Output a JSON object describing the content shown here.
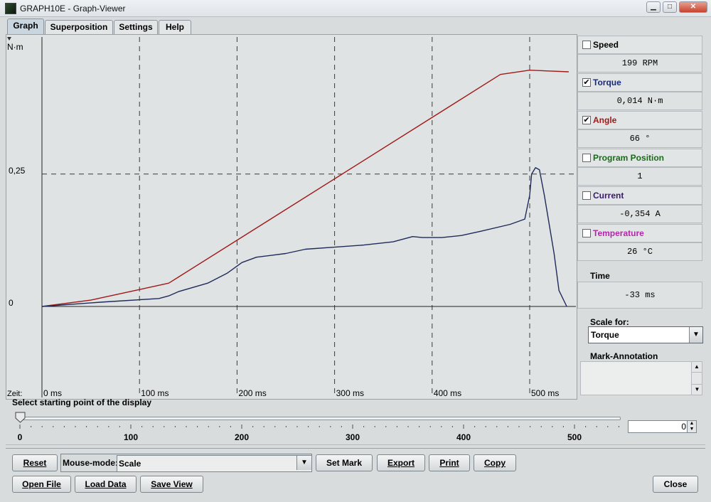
{
  "window": {
    "title": "GRAPH10E - Graph-Viewer",
    "min": "▁",
    "max": "□",
    "close": "✕"
  },
  "tabs": [
    {
      "label": "Graph",
      "active": true
    },
    {
      "label": "Superposition",
      "active": false
    },
    {
      "label": "Settings",
      "active": false
    },
    {
      "label": "Help",
      "active": false
    }
  ],
  "chart": {
    "unit_label": "N·m",
    "y_tick_labels": [
      "0,25",
      "0"
    ],
    "x_axis_prefix": "Zeit:",
    "x_tick_labels": [
      "0 ms",
      "100 ms",
      "200 ms",
      "300 ms",
      "400 ms",
      "500 ms"
    ]
  },
  "chart_data": {
    "type": "line",
    "xlabel": "Zeit:",
    "ylabel": "N·m",
    "xlim": [
      0,
      550
    ],
    "ylim": [
      -0.1,
      0.5
    ],
    "grid": true,
    "series": [
      {
        "name": "Angle",
        "color": "#a01a1a",
        "x": [
          0,
          50,
          100,
          130,
          300,
          470,
          500,
          540
        ],
        "y": [
          0,
          0.012,
          0.032,
          0.044,
          0.241,
          0.438,
          0.446,
          0.443
        ]
      },
      {
        "name": "Torque",
        "color": "#1f2a5a",
        "x": [
          0,
          60,
          120,
          130,
          140,
          170,
          190,
          205,
          220,
          250,
          270,
          300,
          330,
          360,
          380,
          390,
          410,
          430,
          450,
          480,
          495,
          500,
          502,
          506,
          510,
          515,
          525,
          530,
          538
        ],
        "y": [
          0,
          0.008,
          0.015,
          0.02,
          0.028,
          0.044,
          0.063,
          0.083,
          0.093,
          0.1,
          0.108,
          0.112,
          0.116,
          0.122,
          0.132,
          0.13,
          0.13,
          0.134,
          0.142,
          0.155,
          0.165,
          0.21,
          0.25,
          0.262,
          0.258,
          0.21,
          0.1,
          0.03,
          0.0
        ]
      }
    ],
    "reference_line_y": 0.25
  },
  "signals": [
    {
      "label": "Speed",
      "checked": false,
      "value": "199 RPM",
      "color": "#000000"
    },
    {
      "label": "Torque",
      "checked": true,
      "value": "0,014 N·m",
      "color": "#1a2a78"
    },
    {
      "label": "Angle",
      "checked": true,
      "value": "66 °",
      "color": "#a01a1a"
    },
    {
      "label": "Program Position",
      "checked": false,
      "value": "1",
      "color": "#1a6a1a"
    },
    {
      "label": "Current",
      "checked": false,
      "value": "-0,354 A",
      "color": "#3a1a6a"
    },
    {
      "label": "Temperature",
      "checked": false,
      "value": "26 °C",
      "color": "#b028a8"
    }
  ],
  "check_mark": "✔",
  "time": {
    "label": "Time",
    "value": "-33 ms"
  },
  "scale_for": {
    "label": "Scale for:",
    "value": "Torque"
  },
  "mark_annotation": {
    "label": "Mark-Annotation"
  },
  "slider": {
    "label": "Select starting point of the display",
    "tick_labels": [
      "0",
      "100",
      "200",
      "300",
      "400",
      "500"
    ],
    "value": 0,
    "spinner_value": "0"
  },
  "toolbar": {
    "reset": "Reset",
    "mouse_mode_label": "Mouse-mode:",
    "mouse_mode_value": "Scale",
    "set_mark": "Set Mark",
    "export": "Export",
    "print": "Print",
    "copy": "Copy",
    "open_file": "Open File",
    "load_data": "Load Data",
    "save_view": "Save View",
    "close": "Close"
  },
  "icons": {
    "dropdown": "chevron-down-icon",
    "spinner_up": "arrow-up-icon",
    "spinner_down": "arrow-down-icon"
  }
}
